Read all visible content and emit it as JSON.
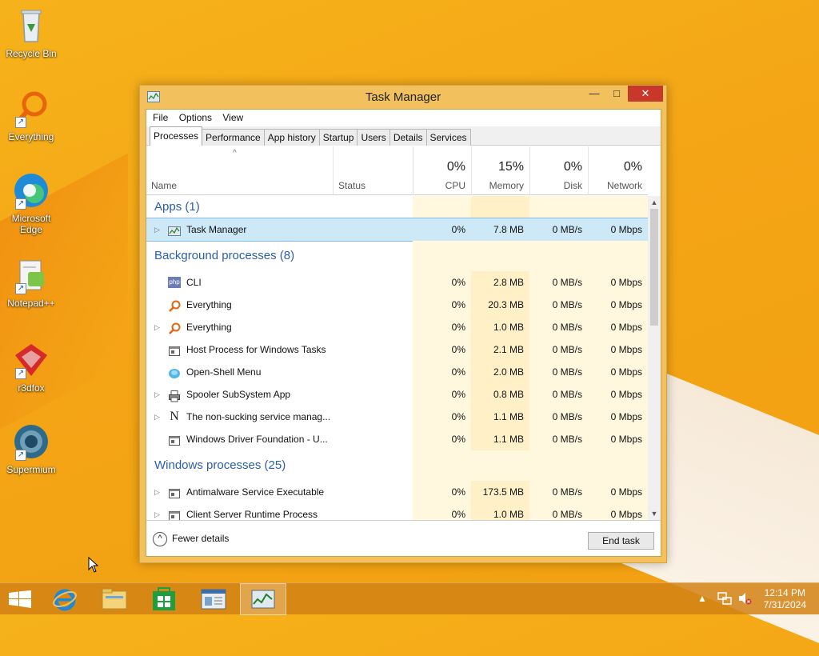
{
  "desktop": {
    "icons": [
      {
        "label": "Recycle Bin",
        "icon": "recycle-bin-icon"
      },
      {
        "label": "Everything",
        "icon": "everything-search-icon"
      },
      {
        "label": "Microsoft Edge",
        "icon": "edge-icon"
      },
      {
        "label": "Notepad++",
        "icon": "notepadpp-icon"
      },
      {
        "label": "r3dfox",
        "icon": "r3dfox-icon"
      },
      {
        "label": "Supermium",
        "icon": "supermium-icon"
      }
    ]
  },
  "window": {
    "title": "Task Manager",
    "controls": {
      "minimize": "—",
      "maximize": "□",
      "close": "✕"
    },
    "menu": [
      "File",
      "Options",
      "View"
    ],
    "tabs": [
      "Processes",
      "Performance",
      "App history",
      "Startup",
      "Users",
      "Details",
      "Services"
    ],
    "active_tab": "Processes",
    "columns": {
      "name": "Name",
      "status": "Status",
      "cpu": {
        "label": "CPU",
        "pct": "0%"
      },
      "memory": {
        "label": "Memory",
        "pct": "15%"
      },
      "disk": {
        "label": "Disk",
        "pct": "0%"
      },
      "network": {
        "label": "Network",
        "pct": "0%"
      }
    },
    "sort_indicator": "^",
    "groups": [
      {
        "title": "Apps (1)"
      },
      {
        "title": "Background processes (8)"
      },
      {
        "title": "Windows processes (25)"
      }
    ],
    "rows": [
      {
        "name": "Task Manager",
        "cpu": "0%",
        "mem": "7.8 MB",
        "disk": "0 MB/s",
        "net": "0 Mbps",
        "expandable": true,
        "selected": true,
        "icon": "task-manager-icon"
      },
      {
        "name": "CLI",
        "cpu": "0%",
        "mem": "2.8 MB",
        "disk": "0 MB/s",
        "net": "0 Mbps",
        "expandable": false,
        "icon": "php-icon",
        "icon_text": "php"
      },
      {
        "name": "Everything",
        "cpu": "0%",
        "mem": "20.3 MB",
        "disk": "0 MB/s",
        "net": "0 Mbps",
        "expandable": false,
        "icon": "everything-search-icon"
      },
      {
        "name": "Everything",
        "cpu": "0%",
        "mem": "1.0 MB",
        "disk": "0 MB/s",
        "net": "0 Mbps",
        "expandable": true,
        "icon": "everything-search-icon"
      },
      {
        "name": "Host Process for Windows Tasks",
        "cpu": "0%",
        "mem": "2.1 MB",
        "disk": "0 MB/s",
        "net": "0 Mbps",
        "expandable": false,
        "icon": "window-process-icon"
      },
      {
        "name": "Open-Shell Menu",
        "cpu": "0%",
        "mem": "2.0 MB",
        "disk": "0 MB/s",
        "net": "0 Mbps",
        "expandable": false,
        "icon": "open-shell-icon"
      },
      {
        "name": "Spooler SubSystem App",
        "cpu": "0%",
        "mem": "0.8 MB",
        "disk": "0 MB/s",
        "net": "0 Mbps",
        "expandable": true,
        "icon": "printer-icon"
      },
      {
        "name": "The non-sucking service manag...",
        "cpu": "0%",
        "mem": "1.1 MB",
        "disk": "0 MB/s",
        "net": "0 Mbps",
        "expandable": true,
        "icon": "nssm-icon",
        "icon_text": "N"
      },
      {
        "name": "Windows Driver Foundation - U...",
        "cpu": "0%",
        "mem": "1.1 MB",
        "disk": "0 MB/s",
        "net": "0 Mbps",
        "expandable": false,
        "icon": "window-process-icon"
      },
      {
        "name": "Antimalware Service Executable",
        "cpu": "0%",
        "mem": "173.5 MB",
        "disk": "0 MB/s",
        "net": "0 Mbps",
        "expandable": true,
        "icon": "window-process-icon"
      },
      {
        "name": "Client Server Runtime Process",
        "cpu": "0%",
        "mem": "1.0 MB",
        "disk": "0 MB/s",
        "net": "0 Mbps",
        "expandable": true,
        "icon": "window-process-icon"
      }
    ],
    "footer": {
      "fewer_details": "Fewer details",
      "end_task": "End task"
    }
  },
  "taskbar": {
    "items": [
      "start-icon",
      "internet-explorer-icon",
      "file-explorer-icon",
      "store-icon",
      "control-panel-icon",
      "task-manager-icon"
    ],
    "active_item": "task-manager-icon",
    "clock_time": "12:14 PM",
    "clock_date": "7/31/2024",
    "tray_icons": [
      "show-hidden-icons-arrow",
      "network-icon",
      "volume-muted-icon"
    ]
  },
  "colors": {
    "desktop_bg": "#f4a516",
    "window_frame": "#f2c15d",
    "group_title": "#2b5ea8",
    "close_button": "#c7372a",
    "selected_row": "#cde8f6"
  }
}
